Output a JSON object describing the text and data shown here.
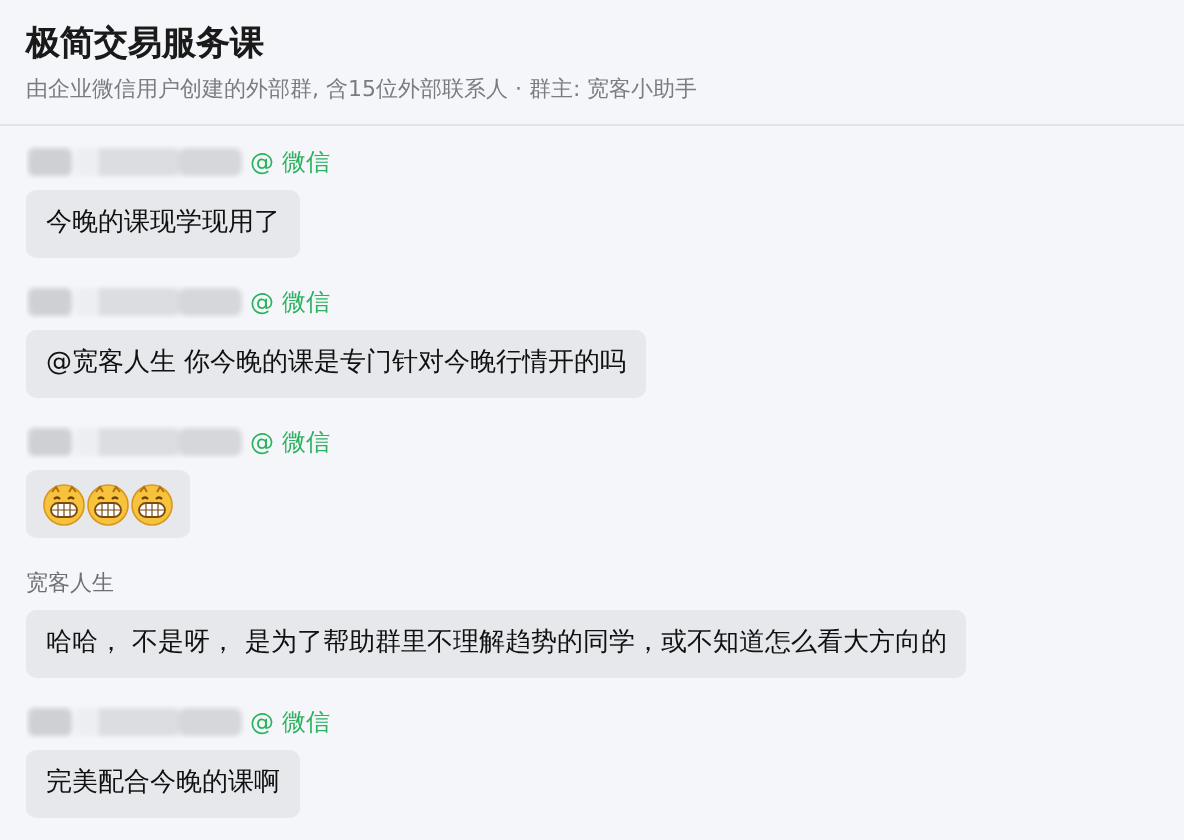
{
  "header": {
    "title": "极简交易服务课",
    "subtitle": "由企业微信用户创建的外部群, 含15位外部联系人 · 群主: 宽客小助手"
  },
  "messages": [
    {
      "sender": {
        "kind": "blurred",
        "tag": "@ 微信"
      },
      "kind": "text",
      "text": "今晚的课现学现用了"
    },
    {
      "sender": {
        "kind": "blurred",
        "tag": "@ 微信"
      },
      "kind": "text",
      "text": "@宽客人生 你今晚的课是专门针对今晚行情开的吗"
    },
    {
      "sender": {
        "kind": "blurred",
        "tag": "@ 微信"
      },
      "kind": "emoji",
      "emoji": [
        {
          "kind": "grin"
        },
        {
          "kind": "grin"
        },
        {
          "kind": "grin"
        }
      ]
    },
    {
      "sender": {
        "kind": "named",
        "name": "宽客人生"
      },
      "kind": "text",
      "text": "哈哈， 不是呀， 是为了帮助群里不理解趋势的同学，或不知道怎么看大方向的"
    },
    {
      "sender": {
        "kind": "blurred",
        "tag": "@ 微信"
      },
      "kind": "text",
      "text": "完美配合今晚的课啊"
    }
  ]
}
